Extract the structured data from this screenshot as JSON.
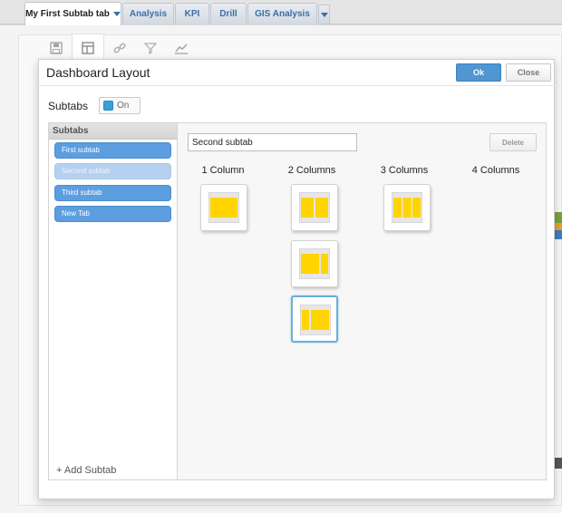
{
  "tabs": [
    {
      "label": "My First Subtab tab",
      "active": true
    },
    {
      "label": "Analysis",
      "active": false
    },
    {
      "label": "KPI",
      "active": false
    },
    {
      "label": "Drill",
      "active": false
    },
    {
      "label": "GIS Analysis",
      "active": false
    }
  ],
  "toolbar_icons": [
    "save-icon",
    "layout-icon",
    "link-icon",
    "filter-icon",
    "chart-icon"
  ],
  "dialog": {
    "title": "Dashboard Layout",
    "ok_label": "Ok",
    "close_label": "Close",
    "subtabs_label": "Subtabs",
    "toggle_label": "On",
    "panel_header": "Subtabs",
    "subtabs": [
      {
        "label": "First subtab",
        "selected": false
      },
      {
        "label": "Second subtab",
        "selected": true
      },
      {
        "label": "Third subtab",
        "selected": false
      },
      {
        "label": "New Tab",
        "selected": false
      }
    ],
    "add_subtab_label": "+ Add Subtab",
    "name_value": "Second subtab",
    "delete_label": "Delete",
    "columns": [
      "1 Column",
      "2 Columns",
      "3 Columns",
      "4 Columns"
    ]
  },
  "colors": {
    "accent": "#4f96d2",
    "thumb_fill": "#ffd400",
    "selected_border": "#6ab0d8"
  }
}
